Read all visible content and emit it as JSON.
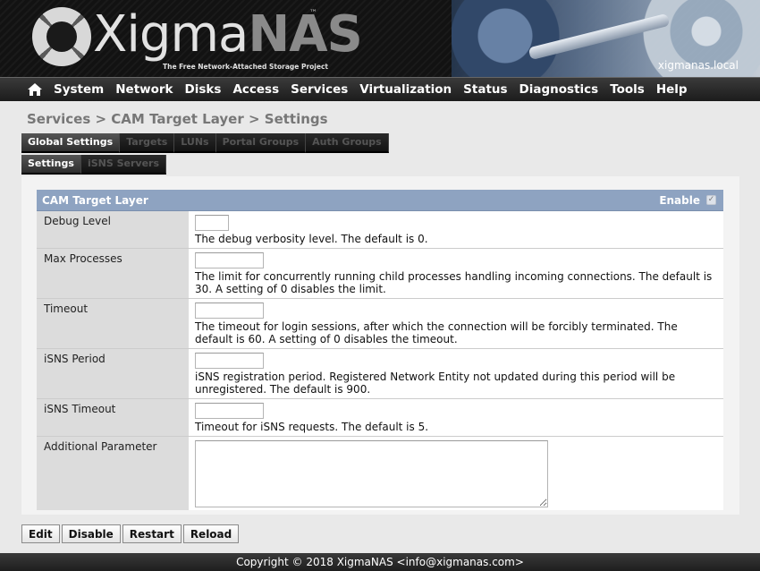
{
  "header": {
    "logo_text_light": "Xigma",
    "logo_text_dark": "NAS",
    "logo_tm": "™",
    "logo_tagline": "The Free Network-Attached Storage Project",
    "hostname": "xigmanas.local"
  },
  "nav": {
    "items": [
      "System",
      "Network",
      "Disks",
      "Access",
      "Services",
      "Virtualization",
      "Status",
      "Diagnostics",
      "Tools",
      "Help"
    ]
  },
  "breadcrumb": "Services > CAM Target Layer > Settings",
  "tabs_primary": [
    {
      "label": "Global Settings",
      "active": true
    },
    {
      "label": "Targets",
      "active": false
    },
    {
      "label": "LUNs",
      "active": false
    },
    {
      "label": "Portal Groups",
      "active": false
    },
    {
      "label": "Auth Groups",
      "active": false
    }
  ],
  "tabs_secondary": [
    {
      "label": "Settings",
      "active": true
    },
    {
      "label": "iSNS Servers",
      "active": false
    }
  ],
  "form": {
    "title": "CAM Target Layer",
    "enable_label": "Enable",
    "enable_checked": true,
    "rows": [
      {
        "label": "Debug Level",
        "value": "",
        "desc": "The debug verbosity level. The default is 0."
      },
      {
        "label": "Max Processes",
        "value": "",
        "desc": "The limit for concurrently running child processes handling incoming connections. The default is 30. A setting of 0 disables the limit."
      },
      {
        "label": "Timeout",
        "value": "",
        "desc": "The timeout for login sessions, after which the connection will be forcibly terminated. The default is 60. A setting of 0 disables the timeout."
      },
      {
        "label": "iSNS Period",
        "value": "",
        "desc": "iSNS registration period. Registered Network Entity not updated during this period will be unregistered. The default is 900."
      },
      {
        "label": "iSNS Timeout",
        "value": "",
        "desc": "Timeout for iSNS requests. The default is 5."
      }
    ],
    "additional_label": "Additional Parameter",
    "additional_value": ""
  },
  "buttons": [
    "Edit",
    "Disable",
    "Restart",
    "Reload"
  ],
  "footer": "Copyright © 2018 XigmaNAS <info@xigmanas.com>"
}
